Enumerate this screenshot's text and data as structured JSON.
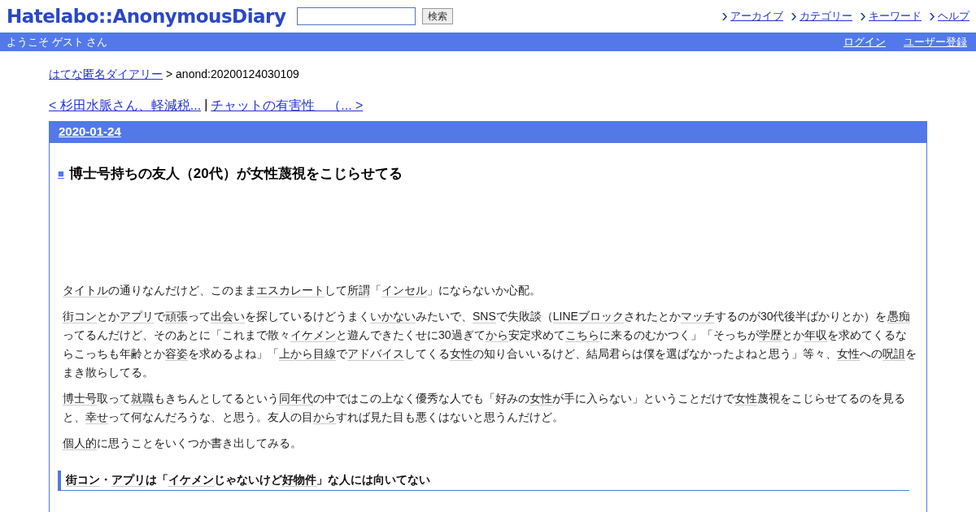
{
  "header": {
    "logo": "Hatelabo::AnonymousDiary",
    "search": {
      "button": "検索"
    },
    "links": [
      "アーカイブ",
      "カテゴリー",
      "キーワード",
      "ヘルプ"
    ]
  },
  "userbar": {
    "welcome": "ようこそ ゲスト さん",
    "links": [
      "ログイン",
      "ユーザー登録"
    ]
  },
  "breadcrumb": {
    "link": "はてな匿名ダイアリー",
    "current": "> anond:20200124030109"
  },
  "pager": {
    "prev": "< 杉田水脈さん、軽減税...",
    "separator": "|",
    "next": "チャットの有害性　（... >"
  },
  "entry": {
    "date": "2020-01-24",
    "mark": "■",
    "title": "博士号持ちの友人（20代）が女性蔑視をこじらせてる",
    "paragraphs": [
      [
        {
          "text": "タイトル",
          "keyword": true
        },
        {
          "text": "の通りなんだけど、このまま",
          "keyword": false
        },
        {
          "text": "エスカレート",
          "keyword": true
        },
        {
          "text": "して",
          "keyword": false
        },
        {
          "text": "所謂",
          "keyword": true
        },
        {
          "text": "「",
          "keyword": false
        },
        {
          "text": "インセル",
          "keyword": true
        },
        {
          "text": "」にならないか心配。",
          "keyword": false
        }
      ],
      [
        {
          "text": "街コン",
          "keyword": true
        },
        {
          "text": "とか",
          "keyword": false
        },
        {
          "text": "アプリ",
          "keyword": true
        },
        {
          "text": "で",
          "keyword": false
        },
        {
          "text": "頑張",
          "keyword": true
        },
        {
          "text": "って",
          "keyword": false
        },
        {
          "text": "出会い",
          "keyword": true
        },
        {
          "text": "を探しているけどうまく",
          "keyword": false
        },
        {
          "text": "いかない",
          "keyword": true
        },
        {
          "text": "みたいで、",
          "keyword": false
        },
        {
          "text": "SNS",
          "keyword": true
        },
        {
          "text": "で失敗談（",
          "keyword": false
        },
        {
          "text": "LINEブロック",
          "keyword": true
        },
        {
          "text": "されたとか",
          "keyword": false
        },
        {
          "text": "マッチ",
          "keyword": true
        },
        {
          "text": "するのが30代後半ばかりとか）を",
          "keyword": false
        },
        {
          "text": "愚痴",
          "keyword": true
        },
        {
          "text": "ってるんだけど、そのあとに「これまで散々",
          "keyword": false
        },
        {
          "text": "イケメン",
          "keyword": true
        },
        {
          "text": "と遊んできたくせに30過ぎて",
          "keyword": false
        },
        {
          "text": "から",
          "keyword": true
        },
        {
          "text": "安定求めて",
          "keyword": false
        },
        {
          "text": "こちら",
          "keyword": true
        },
        {
          "text": "に来るのむかつく」「そっちが",
          "keyword": false
        },
        {
          "text": "学歴",
          "keyword": true
        },
        {
          "text": "とか",
          "keyword": false
        },
        {
          "text": "年収",
          "keyword": true
        },
        {
          "text": "を求めてくるならこっちも年齢とか",
          "keyword": false
        },
        {
          "text": "容姿",
          "keyword": true
        },
        {
          "text": "を求めるよね」「",
          "keyword": false
        },
        {
          "text": "上から目線",
          "keyword": true
        },
        {
          "text": "で",
          "keyword": false
        },
        {
          "text": "アドバイス",
          "keyword": true
        },
        {
          "text": "してくる",
          "keyword": false
        },
        {
          "text": "女性",
          "keyword": true
        },
        {
          "text": "の知り合いいるけど、結局君らは僕を選ばなかったよねと思う」等々、",
          "keyword": false
        },
        {
          "text": "女性",
          "keyword": true
        },
        {
          "text": "への",
          "keyword": false
        },
        {
          "text": "呪詛",
          "keyword": true
        },
        {
          "text": "をまき散らしてる。",
          "keyword": false
        }
      ],
      [
        {
          "text": "博士号",
          "keyword": true
        },
        {
          "text": "取って",
          "keyword": false
        },
        {
          "text": "就職",
          "keyword": true
        },
        {
          "text": "もきちんとしてるという",
          "keyword": false
        },
        {
          "text": "同年代",
          "keyword": true
        },
        {
          "text": "の中ではこの上なく優秀な人でも「好みの",
          "keyword": false
        },
        {
          "text": "女性",
          "keyword": true
        },
        {
          "text": "が手に入らない」ということだけで",
          "keyword": false
        },
        {
          "text": "女性",
          "keyword": true
        },
        {
          "text": "蔑視をこじらせてるのを見ると、",
          "keyword": false
        },
        {
          "text": "幸せ",
          "keyword": true
        },
        {
          "text": "って何なんだろうな、と思う。友人の目",
          "keyword": false
        },
        {
          "text": "から",
          "keyword": true
        },
        {
          "text": "すれば見た目も悪くはないと思うんだけど。",
          "keyword": false
        }
      ],
      [
        {
          "text": "個人的",
          "keyword": true
        },
        {
          "text": "に思うことをいくつか書き出してみる。",
          "keyword": false
        }
      ]
    ],
    "section_heading": [
      {
        "text": "街コン",
        "keyword": true
      },
      {
        "text": "・",
        "keyword": false
      },
      {
        "text": "アプリ",
        "keyword": true
      },
      {
        "text": "は「",
        "keyword": false
      },
      {
        "text": "イケメン",
        "keyword": true
      },
      {
        "text": "じゃないけど",
        "keyword": false
      },
      {
        "text": "好物件",
        "keyword": true
      },
      {
        "text": "」な人には向いてない",
        "keyword": false
      }
    ]
  }
}
